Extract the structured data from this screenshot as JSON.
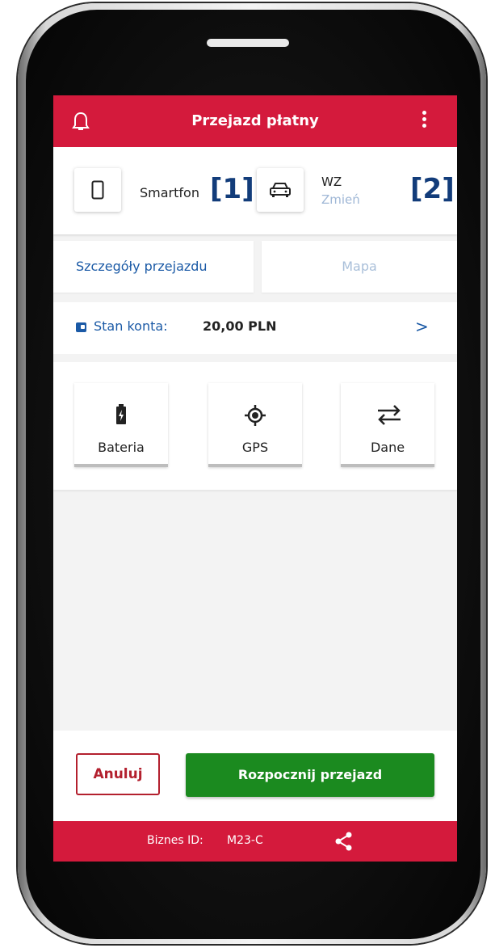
{
  "header": {
    "title": "Przejazd płatny"
  },
  "device": {
    "type_label": "Smartfon",
    "vehicle_code": "WZ",
    "change_label": "Zmień"
  },
  "markers": {
    "one": "[1]",
    "two": "[2]"
  },
  "tabs": [
    {
      "label": "Szczegóły przejazdu",
      "active": true
    },
    {
      "label": "Mapa",
      "active": false
    }
  ],
  "account": {
    "label": "Stan konta:",
    "value": "20,00 PLN",
    "chevron": ">"
  },
  "tiles": [
    {
      "label": "Bateria",
      "icon": "battery-charging-icon"
    },
    {
      "label": "GPS",
      "icon": "gps-target-icon"
    },
    {
      "label": "Dane",
      "icon": "data-transfer-icon"
    }
  ],
  "actions": {
    "cancel_label": "Anuluj",
    "start_label": "Rozpocznij przejazd"
  },
  "footer": {
    "business_label": "Biznes ID:",
    "business_value": "M23-C"
  },
  "colors": {
    "brand_red": "#d41a3c",
    "link_blue": "#1b5aa6",
    "start_green": "#1b8a1f",
    "marker_navy": "#123c7a"
  }
}
